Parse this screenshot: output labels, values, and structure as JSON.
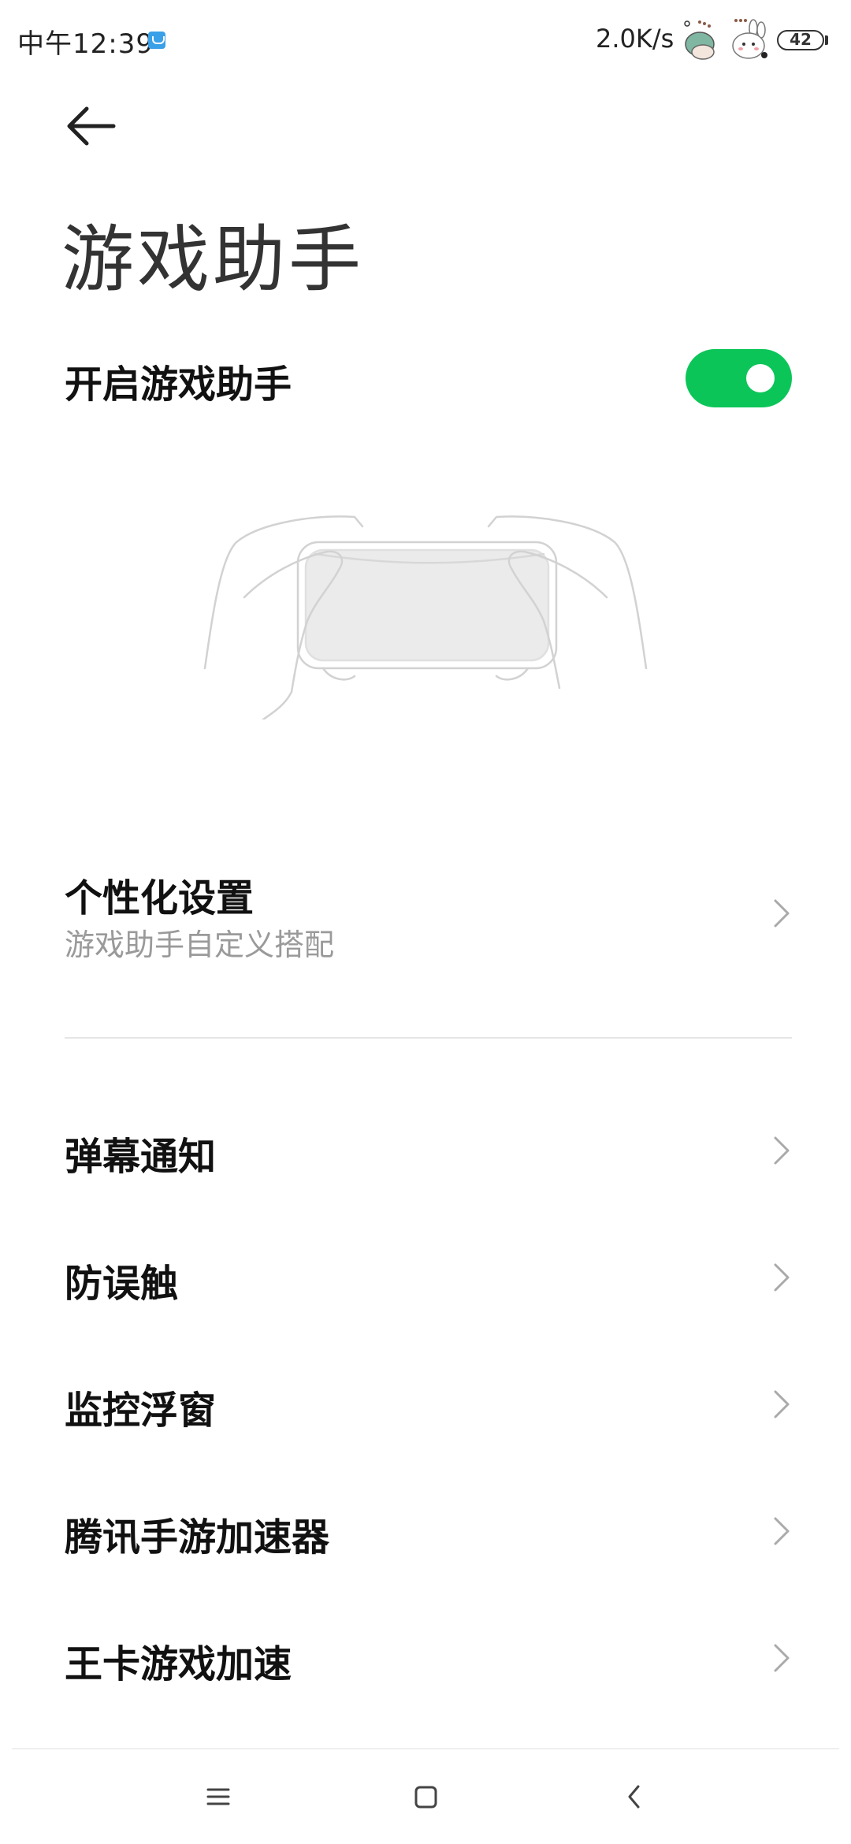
{
  "status_bar": {
    "time": "中午12:39",
    "network_speed": "2.0K/s",
    "battery": "42"
  },
  "page": {
    "title": "游戏助手"
  },
  "toggle": {
    "label": "开启游戏助手",
    "on": true,
    "color": "#0cc559"
  },
  "personalization": {
    "title": "个性化设置",
    "subtitle": "游戏助手自定义搭配"
  },
  "menu_items": [
    {
      "label": "弹幕通知"
    },
    {
      "label": "防误触"
    },
    {
      "label": "监控浮窗"
    },
    {
      "label": "腾讯手游加速器"
    },
    {
      "label": "王卡游戏加速"
    }
  ],
  "nav_bar": {
    "icons": [
      "menu-icon",
      "home-icon",
      "back-icon"
    ]
  }
}
